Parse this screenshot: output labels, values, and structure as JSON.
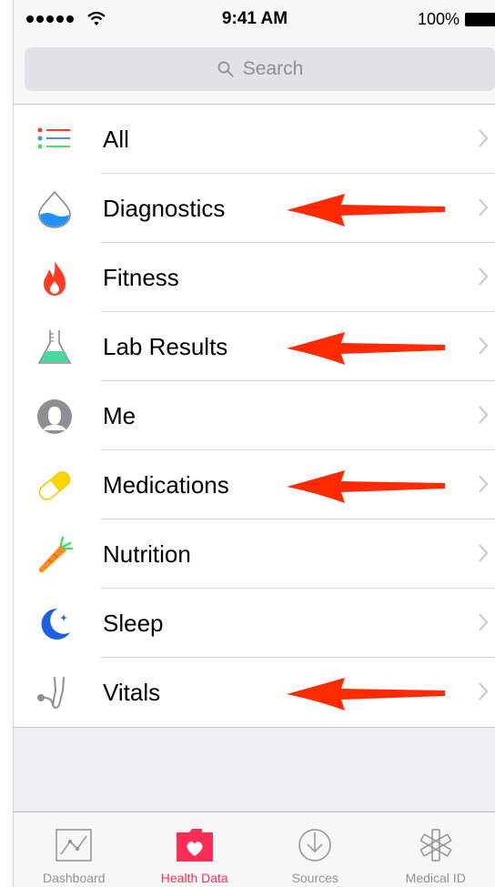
{
  "status_bar": {
    "time": "9:41 AM",
    "battery": "100%"
  },
  "search": {
    "placeholder": "Search"
  },
  "categories": [
    {
      "label": "All",
      "icon": "list-icon",
      "annotated": false
    },
    {
      "label": "Diagnostics",
      "icon": "water-drop-icon",
      "annotated": true
    },
    {
      "label": "Fitness",
      "icon": "flame-icon",
      "annotated": false
    },
    {
      "label": "Lab Results",
      "icon": "flask-icon",
      "annotated": true
    },
    {
      "label": "Me",
      "icon": "person-icon",
      "annotated": false
    },
    {
      "label": "Medications",
      "icon": "pill-icon",
      "annotated": true
    },
    {
      "label": "Nutrition",
      "icon": "carrot-icon",
      "annotated": false
    },
    {
      "label": "Sleep",
      "icon": "moon-icon",
      "annotated": false
    },
    {
      "label": "Vitals",
      "icon": "stethoscope-icon",
      "annotated": true
    }
  ],
  "tabs": [
    {
      "label": "Dashboard",
      "icon": "chart-icon",
      "active": false
    },
    {
      "label": "Health Data",
      "icon": "heart-folder-icon",
      "active": true
    },
    {
      "label": "Sources",
      "icon": "download-icon",
      "active": false
    },
    {
      "label": "Medical ID",
      "icon": "asterisk-icon",
      "active": false
    }
  ],
  "colors": {
    "accent": "#ff2d55",
    "annotation_arrow": "#ff2a00",
    "inactive_tab": "#929292",
    "search_field": "#e2e2e6"
  }
}
